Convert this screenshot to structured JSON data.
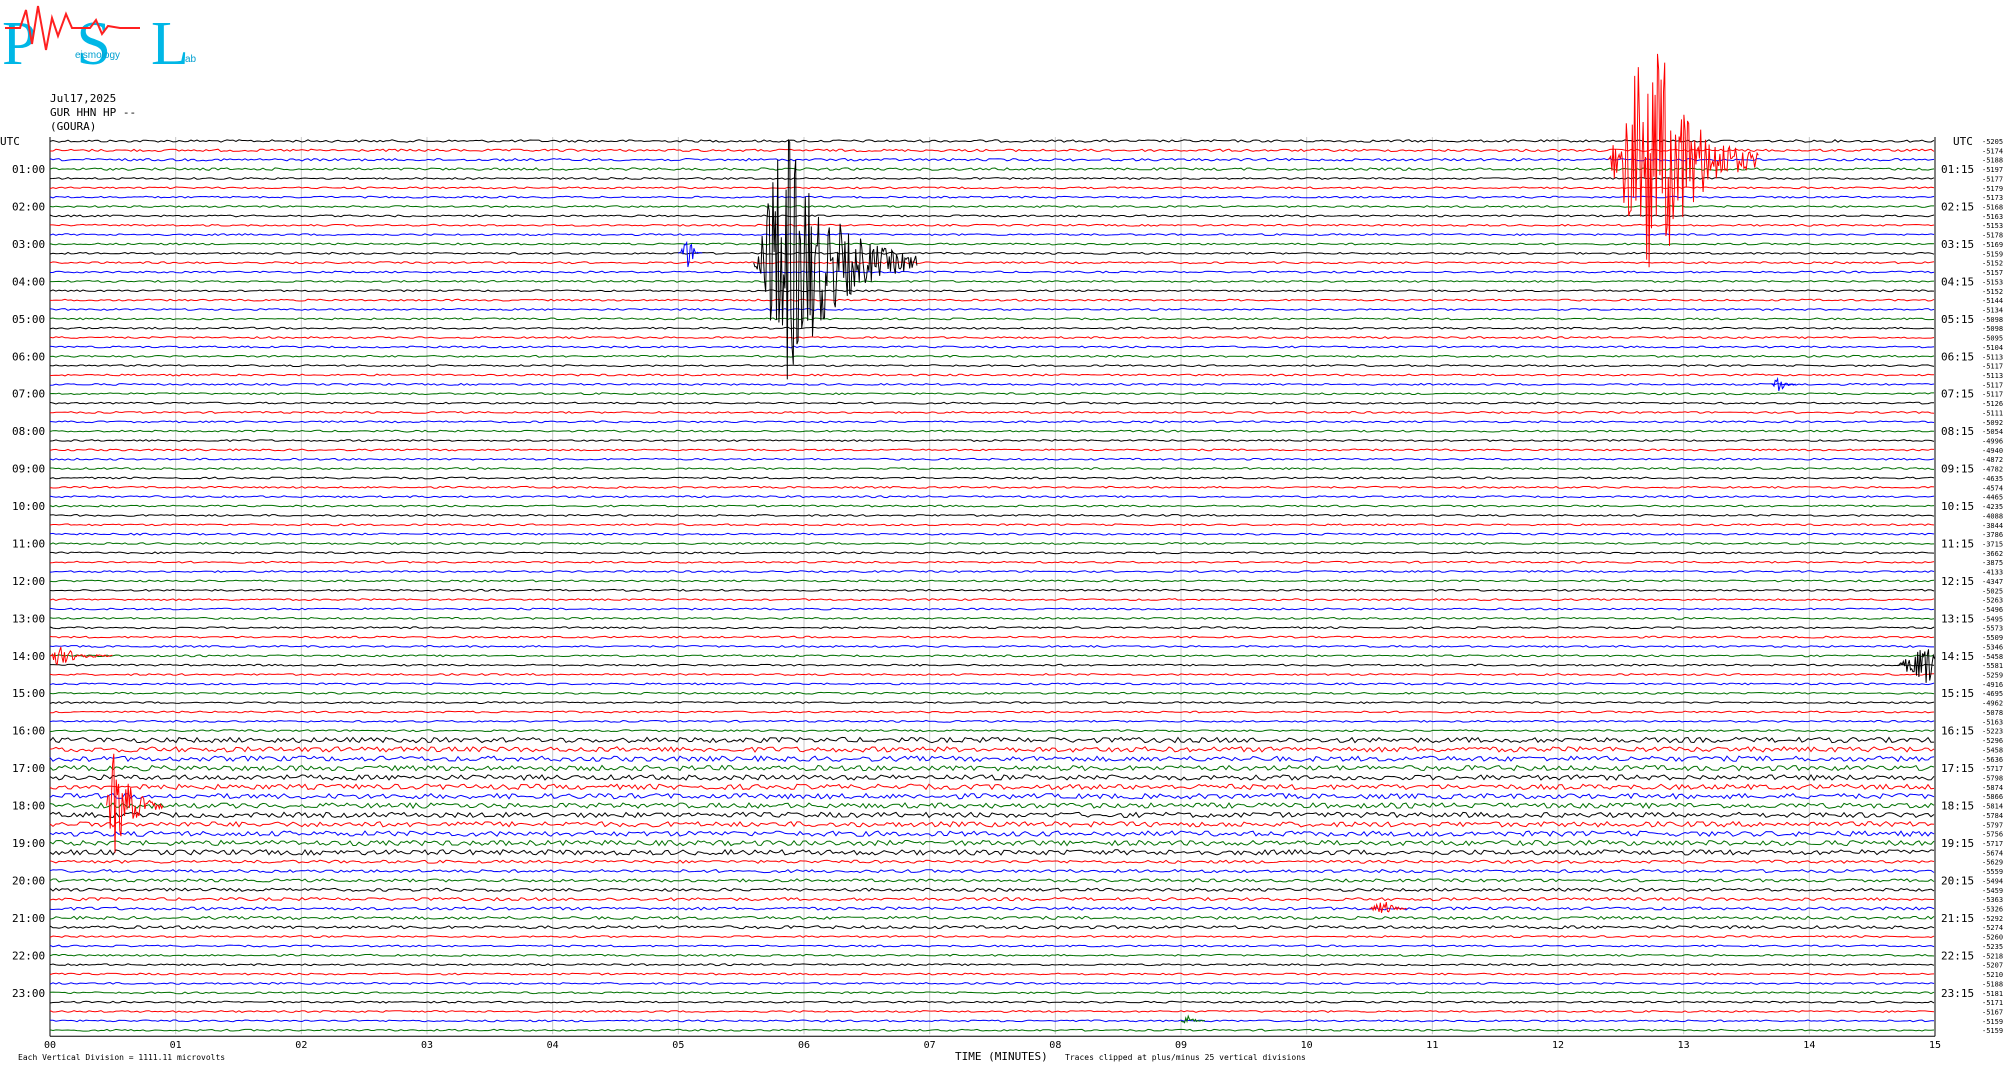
{
  "logo": {
    "text": "PSL",
    "subtitle_fragments": [
      "eismology",
      "ab"
    ]
  },
  "header": {
    "date": "Jul17,2025",
    "channel": "GUR HHN HP --",
    "station": "(GOURA)"
  },
  "axis": {
    "left_title": "UTC",
    "right_title": "UTC",
    "xlabel": "TIME (MINUTES)",
    "x_ticks": [
      "00",
      "01",
      "02",
      "03",
      "04",
      "05",
      "06",
      "07",
      "08",
      "09",
      "10",
      "11",
      "12",
      "13",
      "14",
      "15"
    ],
    "left_hour_labels": [
      "01:00",
      "02:00",
      "03:00",
      "04:00",
      "05:00",
      "06:00",
      "07:00",
      "08:00",
      "09:00",
      "10:00",
      "11:00",
      "12:00",
      "13:00",
      "14:00",
      "15:00",
      "16:00",
      "17:00",
      "18:00",
      "19:00",
      "20:00",
      "21:00",
      "22:00",
      "23:00"
    ],
    "right_hour_labels": [
      "01:15",
      "02:15",
      "03:15",
      "04:15",
      "05:15",
      "06:15",
      "07:15",
      "08:15",
      "09:15",
      "10:15",
      "11:15",
      "12:15",
      "13:15",
      "14:15",
      "15:15",
      "16:15",
      "17:15",
      "18:15",
      "19:15",
      "20:15",
      "21:15",
      "22:15",
      "23:15"
    ]
  },
  "footer": {
    "left_note": "Each Vertical Division = 1111.11 microvolts",
    "right_note": "Traces clipped at plus/minus 25 vertical divisions"
  },
  "chart_data": {
    "type": "line",
    "title": "",
    "xlabel": "TIME (MINUTES)",
    "xlim": [
      0,
      15
    ],
    "trace_colors": [
      "#000000",
      "#ff0000",
      "#0000ff",
      "#007000"
    ],
    "trace_count": 96,
    "minutes_per_trace": 15,
    "offsets": [
      "-5205",
      "-5174",
      "-5188",
      "-5197",
      "-5177",
      "-5179",
      "-5173",
      "-5168",
      "-5163",
      "-5153",
      "-5178",
      "-5169",
      "-5159",
      "-5152",
      "-5157",
      "-5153",
      "-5152",
      "-5144",
      "-5134",
      "-5098",
      "-5098",
      "-5095",
      "-5104",
      "-5113",
      "-5117",
      "-5113",
      "-5117",
      "-5117",
      "-5126",
      "-5111",
      "-5092",
      "-5054",
      "-4996",
      "-4940",
      "-4872",
      "-4782",
      "-4635",
      "-4574",
      "-4465",
      "-4235",
      "-4088",
      "-3844",
      "-3786",
      "-3715",
      "-3662",
      "-3875",
      "-4133",
      "-4347",
      "-5025",
      "-5263",
      "-5496",
      "-5495",
      "-5573",
      "-5509",
      "-5346",
      "-5458",
      "-5581",
      "-5259",
      "-4916",
      "-4695",
      "-4962",
      "-5078",
      "-5163",
      "-5223",
      "-5296",
      "-5458",
      "-5636",
      "-5717",
      "-5798",
      "-5874",
      "-5866",
      "-5814",
      "-5784",
      "-5797",
      "-5756",
      "-5717",
      "-5674",
      "-5629",
      "-5559",
      "-5494",
      "-5459",
      "-5363",
      "-5326",
      "-5292",
      "-5274",
      "-5260",
      "-5235",
      "-5218",
      "-5207",
      "-5210",
      "-5188",
      "-5181",
      "-5171",
      "-5167",
      "-5159",
      "-5159"
    ],
    "events": [
      {
        "trace": 2,
        "minute_start": 12.4,
        "minute_end": 13.6,
        "peak_minute": 12.75,
        "color": "#ff0000",
        "amplitude_divisions": 25,
        "note": "clipped"
      },
      {
        "trace": 13,
        "minute_start": 5.6,
        "minute_end": 6.9,
        "peak_minute": 5.85,
        "color": "#000000",
        "amplitude_divisions": 25,
        "note": "clipped"
      },
      {
        "trace": 12,
        "minute_start": 5.0,
        "minute_end": 5.2,
        "peak_minute": 5.08,
        "color": "#0000ff",
        "amplitude_divisions": 3
      },
      {
        "trace": 55,
        "minute_start": 0.0,
        "minute_end": 0.5,
        "peak_minute": 0.05,
        "color": "#ff0000",
        "amplitude_divisions": 2
      },
      {
        "trace": 71,
        "minute_start": 0.45,
        "minute_end": 0.9,
        "peak_minute": 0.5,
        "color": "#ff0000",
        "amplitude_divisions": 10
      },
      {
        "trace": 56,
        "minute_start": 14.7,
        "minute_end": 15.0,
        "peak_minute": 14.95,
        "color": "#000000",
        "amplitude_divisions": 4
      },
      {
        "trace": 26,
        "minute_start": 13.7,
        "minute_end": 13.9,
        "peak_minute": 13.75,
        "color": "#0000ff",
        "amplitude_divisions": 2
      },
      {
        "trace": 82,
        "minute_start": 10.5,
        "minute_end": 10.8,
        "peak_minute": 10.62,
        "color": "#ff0000",
        "amplitude_divisions": 1.5
      },
      {
        "trace": 94,
        "minute_start": 9.0,
        "minute_end": 9.2,
        "peak_minute": 9.05,
        "color": "#007000",
        "amplitude_divisions": 1
      }
    ]
  }
}
